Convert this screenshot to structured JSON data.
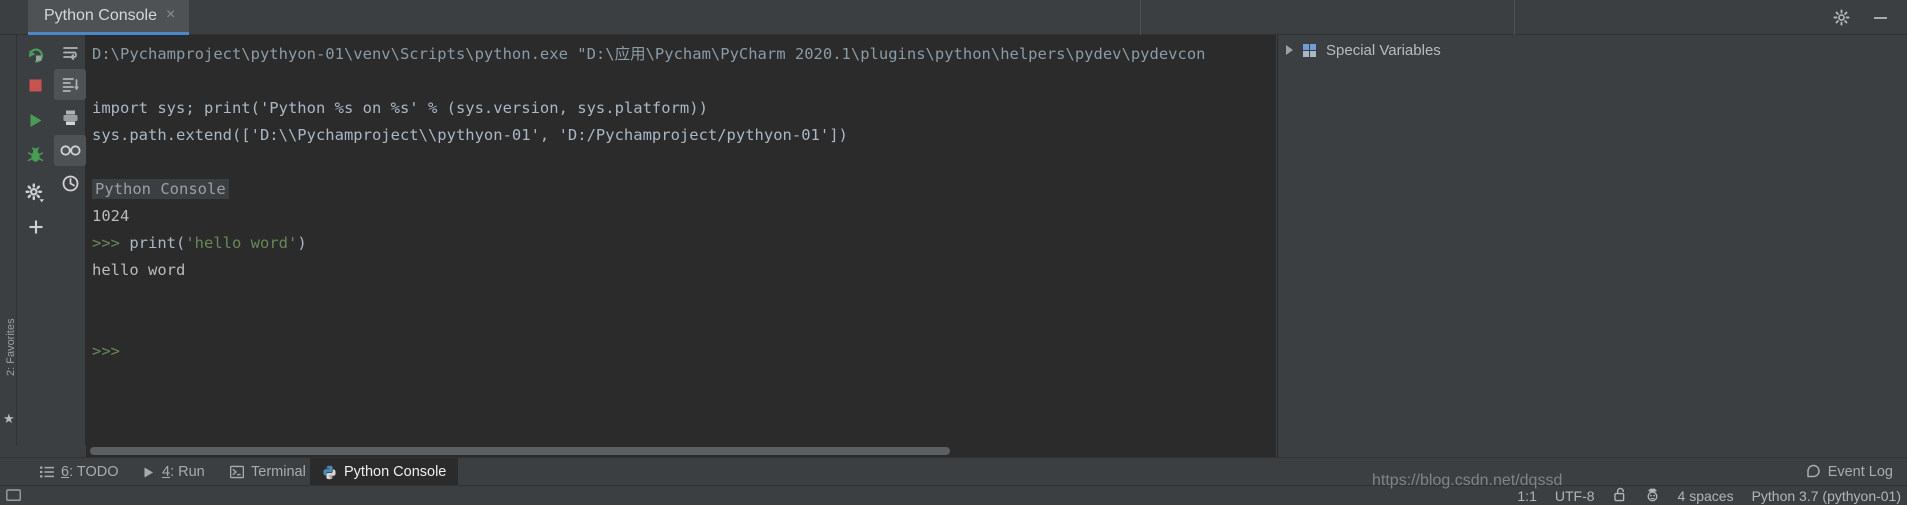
{
  "window": {
    "tab_label": "Python Console",
    "tab_close": "×",
    "settings_icon": "gear-icon",
    "minimize_icon": "minimize-icon"
  },
  "favorites_bar": {
    "label": "2: Favorites",
    "star_icon": "star-icon"
  },
  "console_toolbar": {
    "column1": [
      {
        "name": "rerun-button",
        "icon": "rerun-icon",
        "tooltip": "Rerun"
      },
      {
        "name": "stop-button",
        "icon": "stop-icon",
        "tooltip": "Stop"
      },
      {
        "name": "execute-button",
        "icon": "play-icon",
        "tooltip": "Execute"
      },
      {
        "name": "debug-button",
        "icon": "bug-icon",
        "tooltip": "Attach Debugger"
      },
      {
        "name": "settings-button",
        "icon": "gear-dropdown-icon",
        "tooltip": "Settings"
      },
      {
        "name": "add-console-button",
        "icon": "plus-icon",
        "tooltip": "New Console"
      }
    ],
    "column2": [
      {
        "name": "soft-wrap-button",
        "icon": "soft-wrap-icon",
        "tooltip": "Soft-Wrap"
      },
      {
        "name": "scroll-to-end-button",
        "icon": "scroll-to-end-icon",
        "tooltip": "Scroll to the end"
      },
      {
        "name": "print-button",
        "icon": "print-icon",
        "tooltip": "Print"
      },
      {
        "name": "show-variables-button",
        "icon": "glasses-icon",
        "tooltip": "Show Variables",
        "selected": true
      },
      {
        "name": "history-button",
        "icon": "clock-icon",
        "tooltip": "Browse History"
      }
    ]
  },
  "console": {
    "lines": [
      {
        "type": "command",
        "segments": [
          {
            "cls": "seg-cmdline",
            "text": "D:\\Pychamproject\\pythyon-01\\venv\\Scripts\\python.exe \"D:\\应用\\Pycham\\PyCharm 2020.1\\plugins\\python\\helpers\\pydev\\pydevcon"
          }
        ]
      },
      {
        "type": "blank",
        "segments": []
      },
      {
        "type": "code",
        "segments": [
          {
            "cls": "seg-code",
            "text": "import sys; print('Python %s on %s' % (sys.version, sys.platform))"
          }
        ]
      },
      {
        "type": "code",
        "segments": [
          {
            "cls": "seg-code",
            "text": "sys.path.extend(['D:\\\\Pychamproject\\\\pythyon-01', 'D:/Pychamproject/pythyon-01'])"
          }
        ]
      },
      {
        "type": "blank",
        "segments": []
      },
      {
        "type": "title",
        "segments": [
          {
            "cls": "hl-title",
            "text": "Python Console"
          }
        ]
      },
      {
        "type": "output",
        "segments": [
          {
            "cls": "seg-out",
            "text": "1024"
          }
        ]
      },
      {
        "type": "prompt",
        "segments": [
          {
            "cls": "seg-prompt",
            "text": ">>> "
          },
          {
            "cls": "seg-code",
            "text": "print("
          },
          {
            "cls": "seg-str",
            "text": "'hello word'"
          },
          {
            "cls": "seg-code",
            "text": ")"
          }
        ]
      },
      {
        "type": "output",
        "segments": [
          {
            "cls": "seg-out",
            "text": "hello word"
          }
        ]
      },
      {
        "type": "blank",
        "segments": []
      },
      {
        "type": "blank",
        "segments": []
      },
      {
        "type": "prompt",
        "segments": [
          {
            "cls": "seg-prompt",
            "text": ">>>"
          }
        ]
      }
    ]
  },
  "special_variables": {
    "label": "Special Variables",
    "expand_icon": "triangle-right-icon",
    "group_icon": "variables-group-icon"
  },
  "bottom_tabs": [
    {
      "key": "6",
      "label": ": TODO",
      "icon": "todo-list-icon",
      "active": false
    },
    {
      "key": "4",
      "label": ": Run",
      "icon": "run-play-icon",
      "active": false
    },
    {
      "key": "",
      "label": "Terminal",
      "icon": "terminal-icon",
      "active": false
    },
    {
      "key": "",
      "label": "Python Console",
      "icon": "python-icon",
      "active": true
    }
  ],
  "event_log": {
    "label": "Event Log",
    "icon": "notification-icon"
  },
  "status_bar": {
    "caret_position": "1:1",
    "encoding": "UTF-8",
    "lock_icon": "unlocked-icon",
    "inspection_icon": "hector-inspection-icon",
    "indent": "4 spaces",
    "interpreter": "Python 3.7 (pythyon-01)",
    "left_icon": "terminal-window-icon"
  },
  "watermark": {
    "text": "https://blog.csdn.net/dqssd"
  },
  "colors": {
    "editor_background": "#2b2b2b",
    "panel_background": "#3c3f41",
    "accent_blue": "#4a88c7",
    "text_default": "#a9b7c6",
    "string_green": "#6a8759",
    "stop_red": "#c75450",
    "run_green": "#499c54"
  }
}
